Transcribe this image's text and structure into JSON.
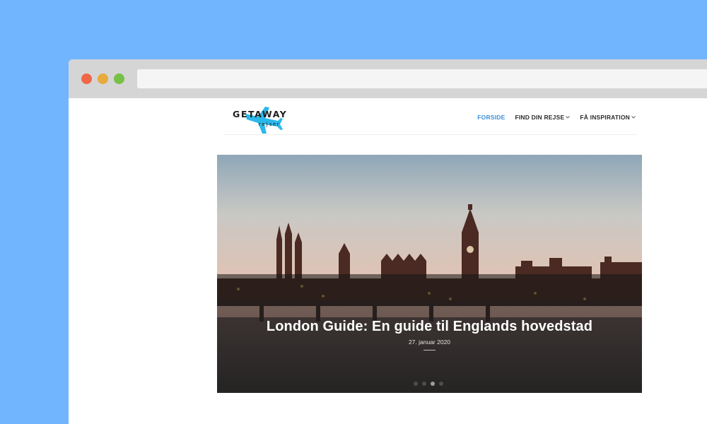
{
  "logo": {
    "main": "GETAWAY",
    "sub": "rejser"
  },
  "nav": {
    "items": [
      {
        "label": "FORSIDE",
        "active": true,
        "has_dropdown": false
      },
      {
        "label": "FIND DIN REJSE",
        "active": false,
        "has_dropdown": true
      },
      {
        "label": "FÅ INSPIRATION",
        "active": false,
        "has_dropdown": true
      }
    ]
  },
  "hero": {
    "title": "London Guide: En guide til Englands hovedstad",
    "date": "27. januar 2020",
    "slides": 4,
    "active_slide": 3
  },
  "colors": {
    "background": "#72b5ff",
    "accent": "#3a8fd9",
    "logo_plane": "#2bb8ea"
  }
}
